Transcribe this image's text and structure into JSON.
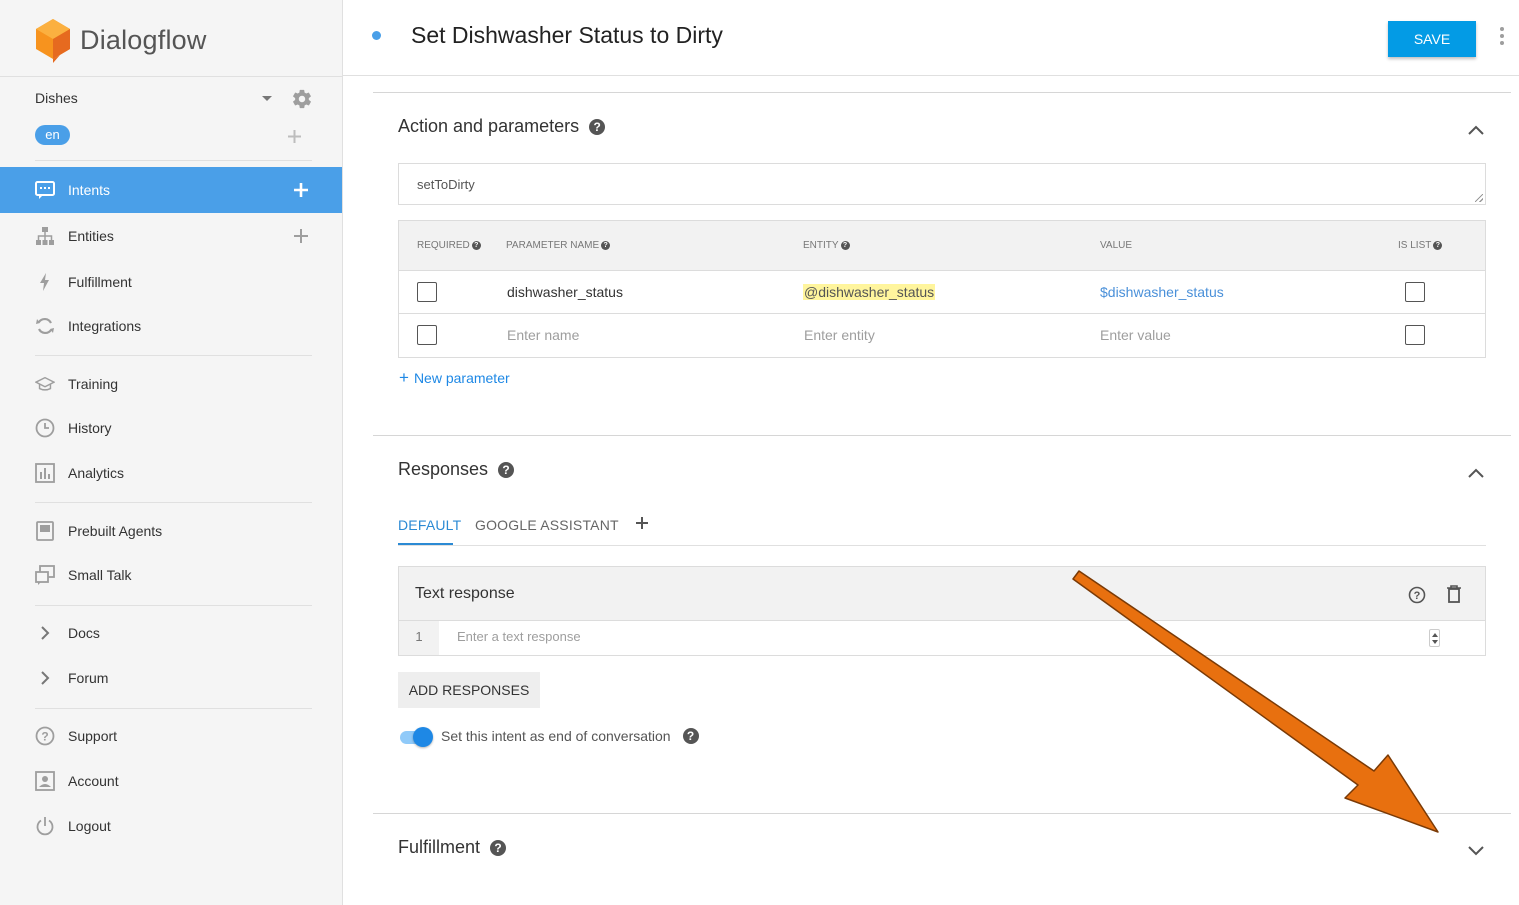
{
  "app": {
    "name": "Dialogflow"
  },
  "agent": {
    "name": "Dishes",
    "language": "en"
  },
  "sidebar": {
    "items": [
      {
        "label": "Intents",
        "icon": "chat-icon",
        "active": true
      },
      {
        "label": "Entities",
        "icon": "hierarchy-icon"
      },
      {
        "label": "Fulfillment",
        "icon": "lightning-icon"
      },
      {
        "label": "Integrations",
        "icon": "sync-icon"
      },
      {
        "label": "Training",
        "icon": "graduation-cap-icon"
      },
      {
        "label": "History",
        "icon": "clock-icon"
      },
      {
        "label": "Analytics",
        "icon": "bar-chart-icon"
      },
      {
        "label": "Prebuilt Agents",
        "icon": "book-icon"
      },
      {
        "label": "Small Talk",
        "icon": "small-talk-icon"
      },
      {
        "label": "Docs",
        "icon": "chevron-right-icon"
      },
      {
        "label": "Forum",
        "icon": "chevron-right-icon"
      },
      {
        "label": "Support",
        "icon": "help-circle-icon"
      },
      {
        "label": "Account",
        "icon": "account-icon"
      },
      {
        "label": "Logout",
        "icon": "power-icon"
      }
    ]
  },
  "header": {
    "title": "Set Dishwasher Status to Dirty",
    "save_label": "SAVE"
  },
  "action_section": {
    "title": "Action and parameters",
    "action_value": "setToDirty",
    "columns": [
      "REQUIRED",
      "PARAMETER NAME",
      "ENTITY",
      "VALUE",
      "IS LIST"
    ],
    "rows": [
      {
        "name": "dishwasher_status",
        "entity": "@dishwasher_status",
        "value": "$dishwasher_status"
      }
    ],
    "placeholders": {
      "name": "Enter name",
      "entity": "Enter entity",
      "value": "Enter value"
    },
    "new_parameter_label": "New parameter"
  },
  "responses_section": {
    "title": "Responses",
    "tabs": [
      "DEFAULT",
      "GOOGLE ASSISTANT"
    ],
    "active_tab": "DEFAULT",
    "text_response_title": "Text response",
    "row_number": "1",
    "text_placeholder": "Enter a text response",
    "add_responses_label": "ADD RESPONSES",
    "end_conversation_label": "Set this intent as end of conversation",
    "end_conversation_enabled": true
  },
  "fulfillment_section": {
    "title": "Fulfillment"
  },
  "colors": {
    "accent": "#4a9fe8",
    "save": "#039be5",
    "annotation_arrow": "#e8700f",
    "entity_highlight": "#fff59d"
  }
}
